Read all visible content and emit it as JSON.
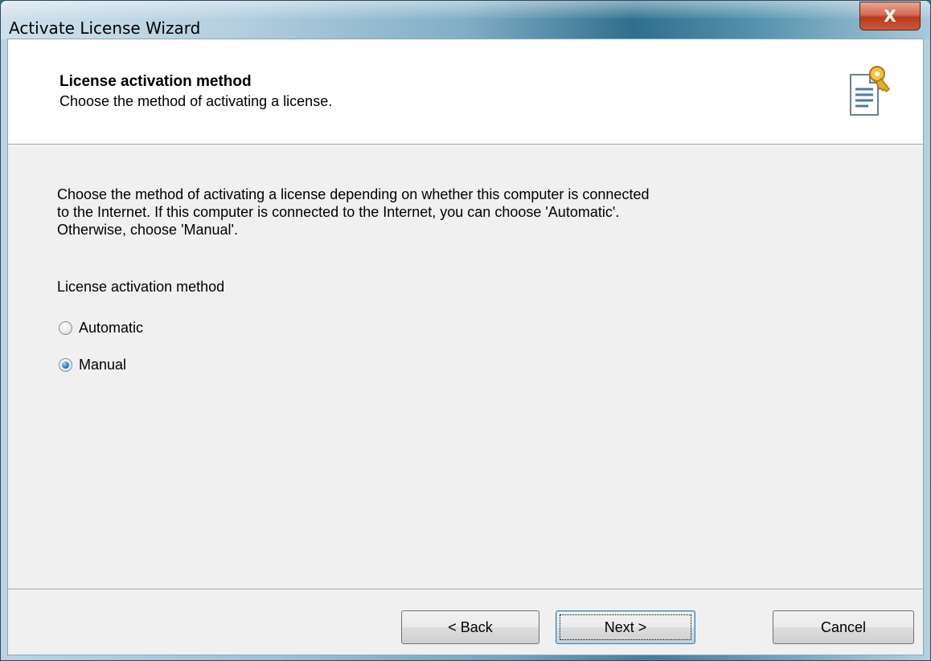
{
  "window": {
    "title": "Activate License Wizard",
    "close_glyph": "X"
  },
  "header": {
    "title": "License activation method",
    "subtitle": "Choose the method of activating a license.",
    "icon": "license-document-key-icon"
  },
  "body": {
    "description_lines": [
      "Choose the method of activating a license depending on whether this computer is connected",
      "to the Internet. If this computer is connected to the Internet, you can choose 'Automatic'.",
      "Otherwise, choose 'Manual'."
    ],
    "group_label": "License activation method",
    "options": [
      {
        "label": "Automatic",
        "checked": false
      },
      {
        "label": "Manual",
        "checked": true
      }
    ]
  },
  "footer": {
    "back_label": "< Back",
    "next_label": "Next >",
    "cancel_label": "Cancel"
  },
  "colors": {
    "accent": "#3c7fb1",
    "close_red": "#c95a3d",
    "dialog_bg": "#f0f0f0"
  }
}
